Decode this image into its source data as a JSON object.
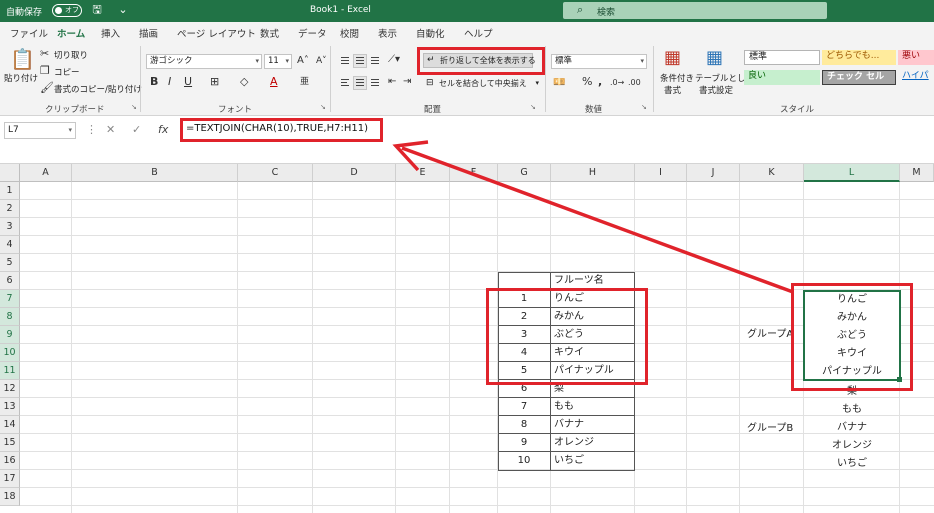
{
  "titlebar": {
    "autosave_label": "自動保存",
    "autosave_state": "オフ",
    "doc_title": "Book1  -  Excel",
    "search_placeholder": "検索"
  },
  "tabs": [
    "ファイル",
    "ホーム",
    "挿入",
    "描画",
    "ページ レイアウト",
    "数式",
    "データ",
    "校閲",
    "表示",
    "自動化",
    "ヘルプ"
  ],
  "active_tab": "ホーム",
  "ribbon": {
    "clipboard": {
      "paste": "貼り付け",
      "cut": "切り取り",
      "copy": "コピー",
      "format_painter": "書式のコピー/貼り付け",
      "label": "クリップボード"
    },
    "font": {
      "name": "游ゴシック",
      "size": "11",
      "label": "フォント"
    },
    "alignment": {
      "wrap_text": "折り返して全体を表示する",
      "merge_center": "セルを結合して中央揃え",
      "label": "配置"
    },
    "number": {
      "format": "標準",
      "label": "数値"
    },
    "styles": {
      "conditional": [
        "条件付き",
        "書式"
      ],
      "as_table": [
        "テーブルとして",
        "書式設定"
      ],
      "cell_styles": [
        "標準",
        "どちらでも...",
        "悪い",
        "良い",
        "チェック セル",
        "ハイパ"
      ],
      "label": "スタイル"
    }
  },
  "formula_bar": {
    "name_box": "L7",
    "fx": "fx",
    "formula": "=TEXTJOIN(CHAR(10),TRUE,H7:H11)"
  },
  "grid": {
    "columns": [
      "A",
      "B",
      "C",
      "D",
      "E",
      "F",
      "G",
      "H",
      "I",
      "J",
      "K",
      "L",
      "M"
    ],
    "selected_column": "L",
    "rows": [
      "1",
      "2",
      "3",
      "4",
      "5",
      "6",
      "7",
      "8",
      "9",
      "10",
      "11",
      "12",
      "13",
      "14",
      "15",
      "16",
      "17",
      "18"
    ],
    "selected_rows": [
      "7",
      "8",
      "9",
      "10",
      "11"
    ]
  },
  "fruit_table": {
    "header": "フルーツ名",
    "rows": [
      {
        "no": "1",
        "name": "りんご"
      },
      {
        "no": "2",
        "name": "みかん"
      },
      {
        "no": "3",
        "name": "ぶどう"
      },
      {
        "no": "4",
        "name": "キウイ"
      },
      {
        "no": "5",
        "name": "パイナップル"
      },
      {
        "no": "6",
        "name": "梨"
      },
      {
        "no": "7",
        "name": "もも"
      },
      {
        "no": "8",
        "name": "バナナ"
      },
      {
        "no": "9",
        "name": "オレンジ"
      },
      {
        "no": "10",
        "name": "いちご"
      }
    ]
  },
  "groups": {
    "group_a_label": "グループA",
    "group_a_items": [
      "りんご",
      "みかん",
      "ぶどう",
      "キウイ",
      "パイナップル"
    ],
    "group_b_label": "グループB",
    "group_b_items": [
      "梨",
      "もも",
      "バナナ",
      "オレンジ",
      "いちご"
    ]
  },
  "colors": {
    "excel_green": "#217346",
    "annotation_red": "#e0232b"
  }
}
